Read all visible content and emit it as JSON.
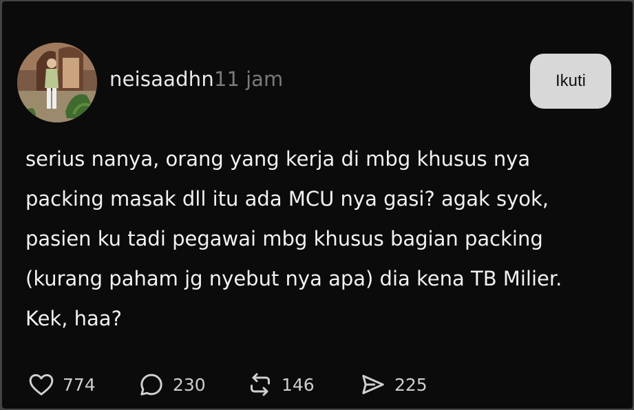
{
  "post": {
    "username": "neisaadhn",
    "time": "11 jam",
    "follow_label": "Ikuti",
    "lines": [
      "serius nanya, orang yang kerja di mbg khusus nya",
      "packing masak dll itu ada MCU nya gasi? agak syok,",
      "pasien ku tadi pegawai mbg khusus bagian packing",
      "(kurang paham jg nyebut nya apa) dia kena TB Milier.",
      "Kek, haa?"
    ]
  },
  "actions": {
    "likes": "774",
    "replies": "230",
    "reposts": "146",
    "shares": "225"
  },
  "icons": {
    "like": "heart-icon",
    "reply": "speech-bubble-icon",
    "repost": "repost-icon",
    "share": "send-icon"
  }
}
